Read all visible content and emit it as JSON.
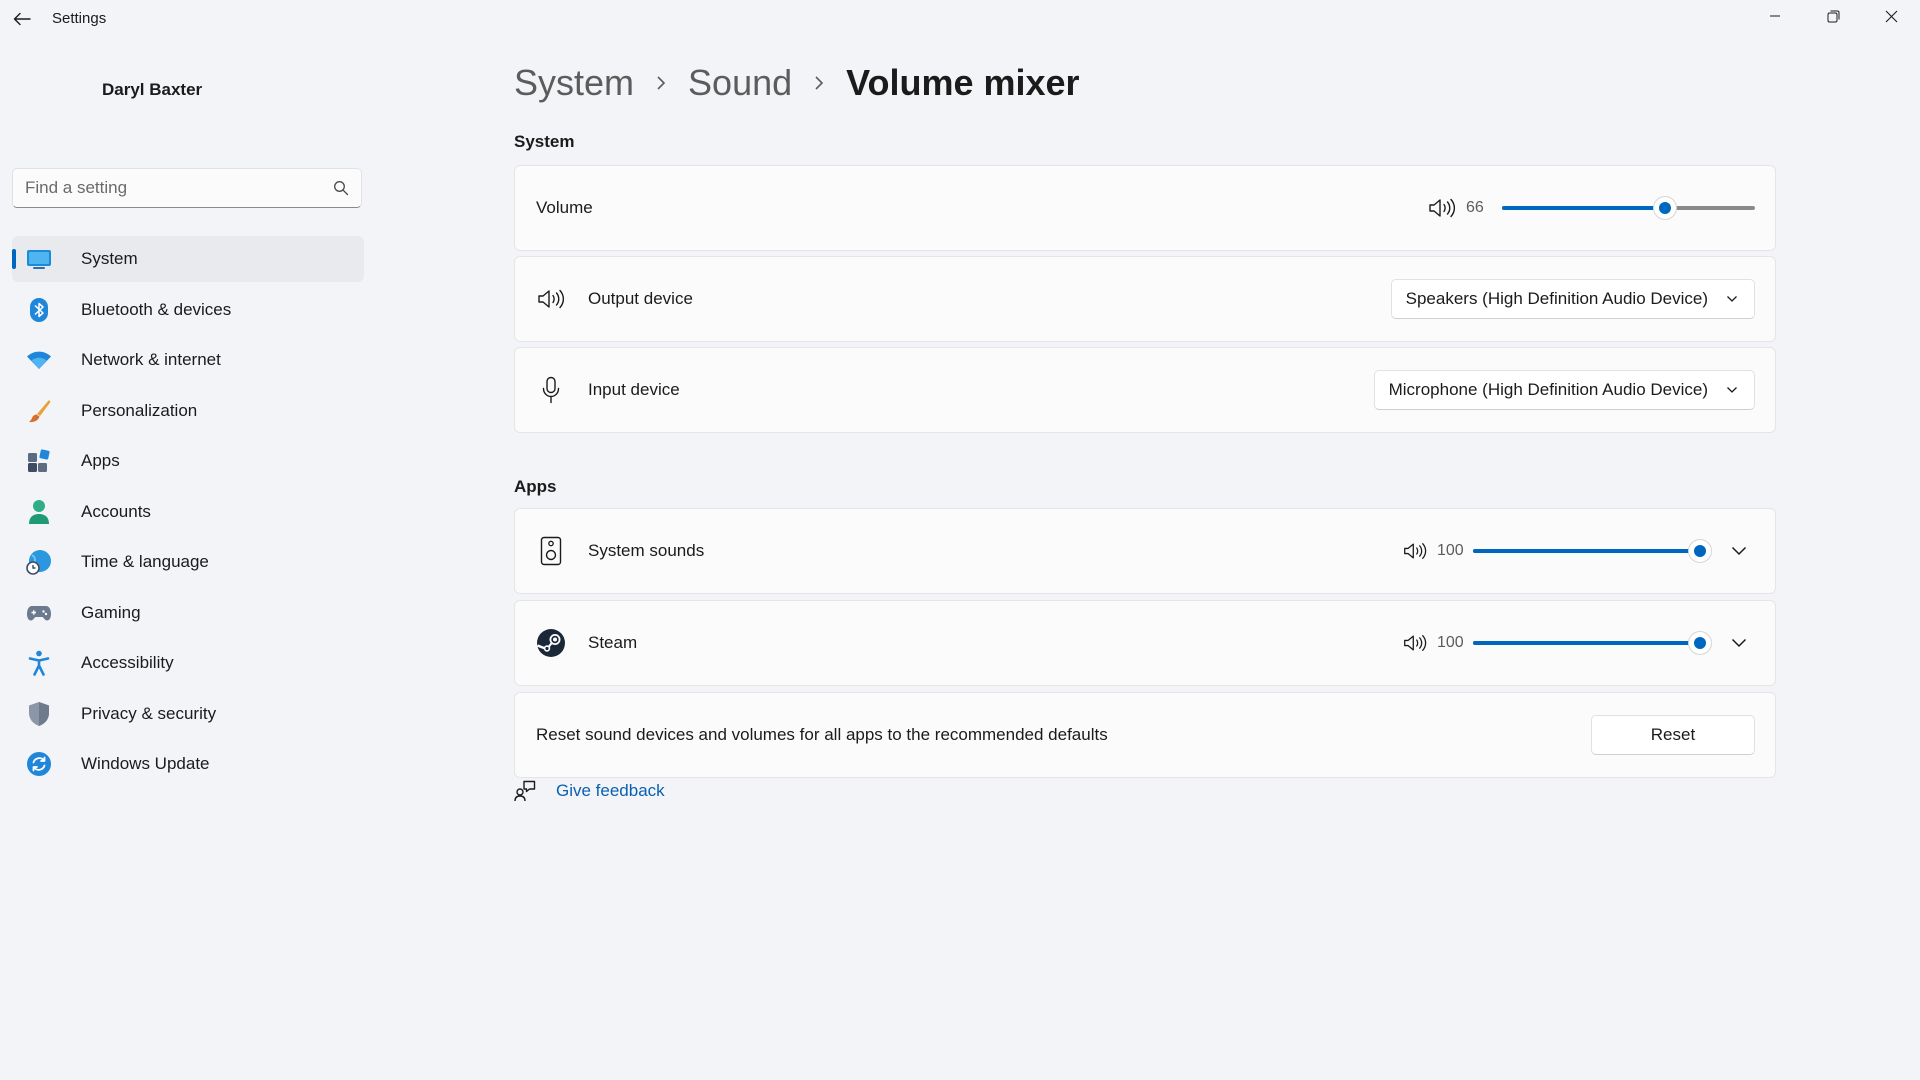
{
  "window": {
    "title": "Settings",
    "back_icon": "back-arrow-icon",
    "controls": [
      "minimize-icon",
      "restore-icon",
      "close-icon"
    ]
  },
  "user": {
    "name": "Daryl Baxter"
  },
  "search": {
    "placeholder": "Find a setting",
    "value": "",
    "icon": "search-icon"
  },
  "sidebar": {
    "active": "System",
    "accent_color": "#0067c0",
    "items": [
      {
        "label": "System",
        "icon": "monitor-icon"
      },
      {
        "label": "Bluetooth & devices",
        "icon": "bluetooth-icon"
      },
      {
        "label": "Network & internet",
        "icon": "wifi-icon"
      },
      {
        "label": "Personalization",
        "icon": "brush-icon"
      },
      {
        "label": "Apps",
        "icon": "apps-icon"
      },
      {
        "label": "Accounts",
        "icon": "person-icon"
      },
      {
        "label": "Time & language",
        "icon": "globe-clock-icon"
      },
      {
        "label": "Gaming",
        "icon": "gamepad-icon"
      },
      {
        "label": "Accessibility",
        "icon": "accessibility-icon"
      },
      {
        "label": "Privacy & security",
        "icon": "shield-icon"
      },
      {
        "label": "Windows Update",
        "icon": "update-icon"
      }
    ]
  },
  "breadcrumb": {
    "items": [
      "System",
      "Sound"
    ],
    "current": "Volume mixer"
  },
  "system_section": {
    "title": "System",
    "volume": {
      "label": "Volume",
      "value": "66",
      "percent": 66,
      "icon": "speaker-icon"
    },
    "output": {
      "label": "Output device",
      "value": "Speakers (High Definition Audio Device)",
      "icon": "speaker-icon"
    },
    "input": {
      "label": "Input device",
      "value": "Microphone (High Definition Audio Device)",
      "icon": "microphone-icon"
    }
  },
  "apps_section": {
    "title": "Apps",
    "apps": [
      {
        "label": "System sounds",
        "value": "100",
        "percent": 100,
        "icon": "speaker-box-icon"
      },
      {
        "label": "Steam",
        "value": "100",
        "percent": 100,
        "icon": "steam-icon"
      }
    ]
  },
  "reset": {
    "text": "Reset sound devices and volumes for all apps to the recommended defaults",
    "button_label": "Reset"
  },
  "feedback": {
    "label": "Give feedback",
    "icon": "feedback-icon"
  }
}
